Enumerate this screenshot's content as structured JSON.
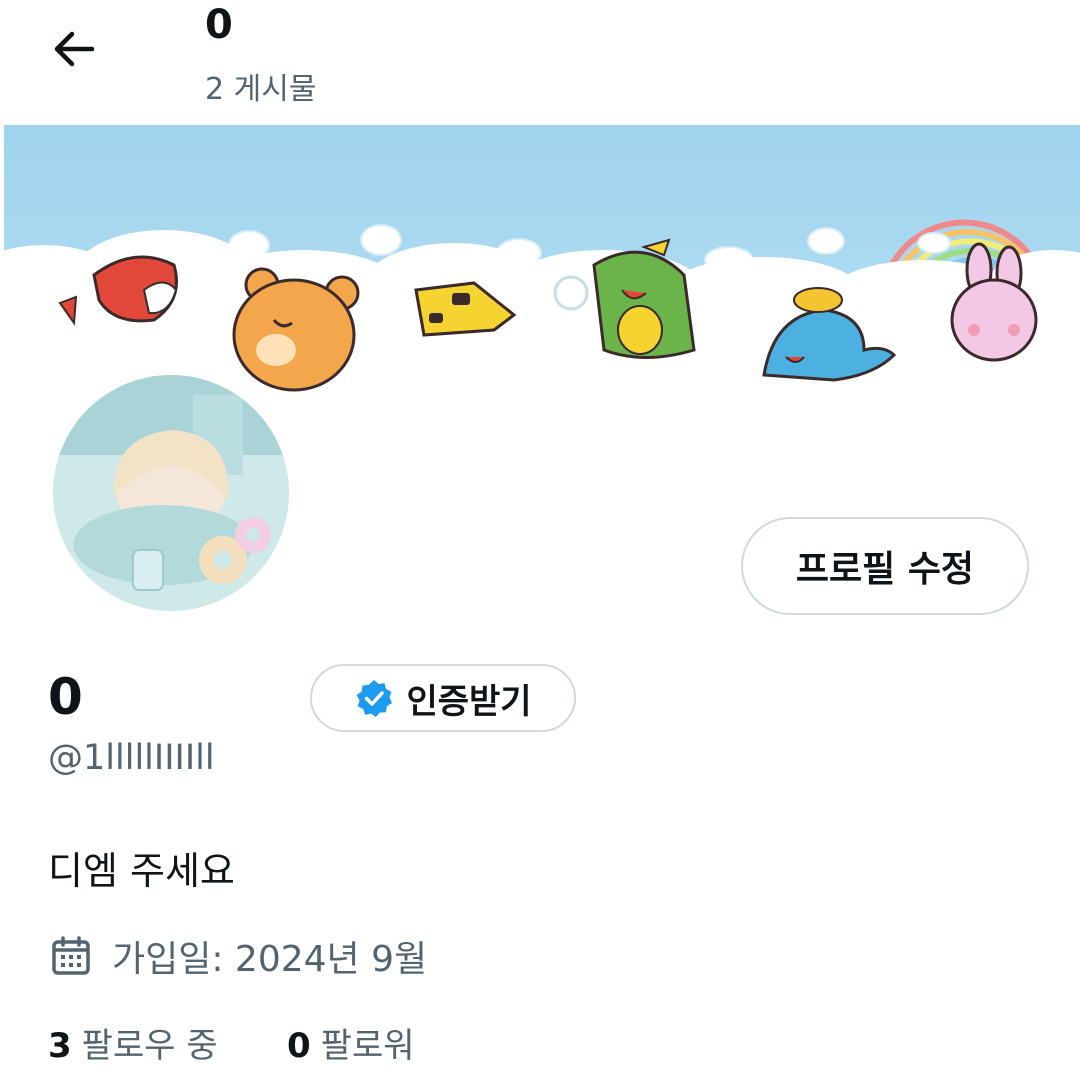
{
  "header": {
    "title": "0",
    "post_count": "2 게시물"
  },
  "profile": {
    "name": "0",
    "handle": "@1lllllIIIIll",
    "bio": "디엠 주세요",
    "joined": "가입일: 2024년 9월",
    "edit_button": "프로필 수정",
    "verify_button": "인증받기"
  },
  "stats": {
    "following_count": "3",
    "following_label": "팔로우 중",
    "followers_count": "0",
    "followers_label": "팔로워"
  },
  "icons": {
    "back": "arrow-left-icon",
    "verified": "verified-badge-icon",
    "calendar": "calendar-icon"
  },
  "colors": {
    "verified_blue": "#1d9bf0",
    "secondary_text": "#536471",
    "banner_sky": "#a6d8ef"
  }
}
